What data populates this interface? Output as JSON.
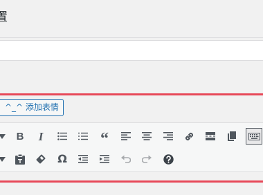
{
  "section": {
    "title": "置"
  },
  "input": {
    "value": ""
  },
  "emoji_button": {
    "label": "^_^ 添加表情"
  },
  "toolbar": {
    "row1": [
      {
        "name": "toolbar-toggle-arrow-icon",
        "glyph": ""
      },
      {
        "name": "bold-button",
        "glyph": "B"
      },
      {
        "name": "italic-button",
        "glyph": "I"
      },
      {
        "name": "bulleted-list-icon",
        "glyph": ""
      },
      {
        "name": "numbered-list-icon",
        "glyph": ""
      },
      {
        "name": "blockquote-button",
        "glyph": "“"
      },
      {
        "name": "align-left-icon",
        "glyph": ""
      },
      {
        "name": "align-center-icon",
        "glyph": ""
      },
      {
        "name": "align-right-icon",
        "glyph": ""
      },
      {
        "name": "insert-link-icon",
        "glyph": ""
      },
      {
        "name": "read-more-icon",
        "glyph": ""
      },
      {
        "name": "page-break-icon",
        "glyph": ""
      },
      {
        "name": "keyboard-icon",
        "glyph": ""
      }
    ],
    "row2": [
      {
        "name": "text-color-arrow-icon",
        "glyph": ""
      },
      {
        "name": "paste-text-icon",
        "glyph": ""
      },
      {
        "name": "clear-formatting-icon",
        "glyph": ""
      },
      {
        "name": "special-character-button",
        "glyph": "Ω"
      },
      {
        "name": "outdent-icon",
        "glyph": ""
      },
      {
        "name": "indent-icon",
        "glyph": ""
      },
      {
        "name": "undo-icon",
        "glyph": ""
      },
      {
        "name": "redo-icon",
        "glyph": ""
      },
      {
        "name": "help-icon",
        "glyph": ""
      }
    ]
  }
}
